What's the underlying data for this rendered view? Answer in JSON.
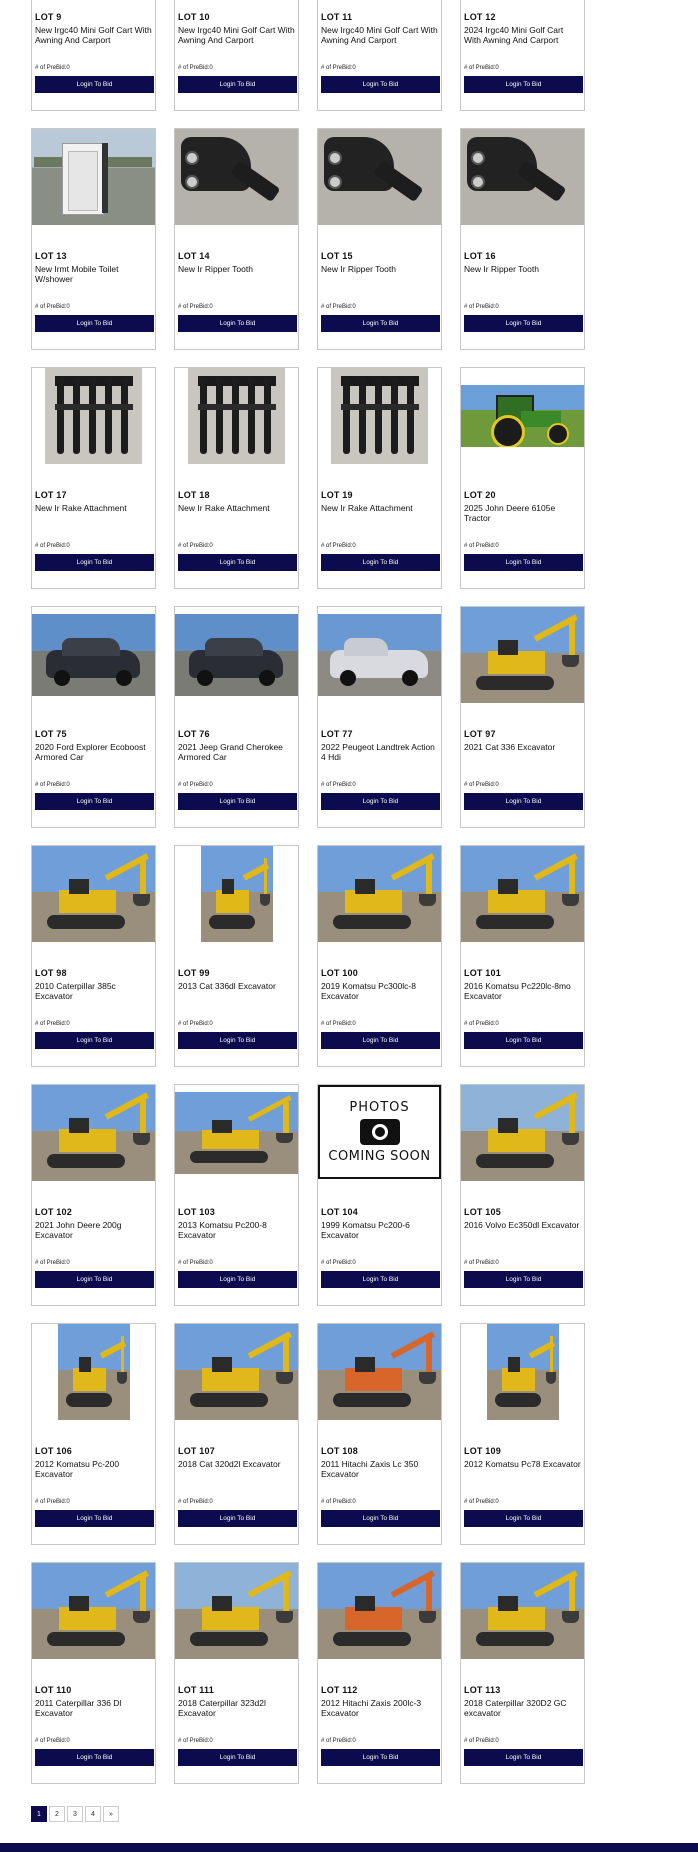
{
  "lots": [
    {
      "lot": "LOT 9",
      "title": "New Irgc40 Mini Golf Cart With Awning And Carport",
      "prebid": "# of PreBid:0",
      "button": "Login To Bid",
      "image": "none"
    },
    {
      "lot": "LOT 10",
      "title": "New Irgc40 Mini Golf Cart With Awning And Carport",
      "prebid": "# of PreBid:0",
      "button": "Login To Bid",
      "image": "none"
    },
    {
      "lot": "LOT 11",
      "title": "New Irgc40 Mini Golf Cart With Awning And Carport",
      "prebid": "# of PreBid:0",
      "button": "Login To Bid",
      "image": "none"
    },
    {
      "lot": "LOT 12",
      "title": "2024 Irgc40 Mini Golf Cart With Awning And Carport",
      "prebid": "# of PreBid:0",
      "button": "Login To Bid",
      "image": "none"
    },
    {
      "lot": "LOT 13",
      "title": "New Irmt Mobile Toilet W/shower",
      "prebid": "# of PreBid:0",
      "button": "Login To Bid",
      "image": "toilet"
    },
    {
      "lot": "LOT 14",
      "title": "New Ir Ripper Tooth",
      "prebid": "# of PreBid:0",
      "button": "Login To Bid",
      "image": "ripper"
    },
    {
      "lot": "LOT 15",
      "title": "New Ir Ripper Tooth",
      "prebid": "# of PreBid:0",
      "button": "Login To Bid",
      "image": "ripper"
    },
    {
      "lot": "LOT 16",
      "title": "New Ir Ripper Tooth",
      "prebid": "# of PreBid:0",
      "button": "Login To Bid",
      "image": "ripper"
    },
    {
      "lot": "LOT 17",
      "title": "New Ir Rake Attachment",
      "prebid": "# of PreBid:0",
      "button": "Login To Bid",
      "image": "rake"
    },
    {
      "lot": "LOT 18",
      "title": "New Ir Rake Attachment",
      "prebid": "# of PreBid:0",
      "button": "Login To Bid",
      "image": "rake"
    },
    {
      "lot": "LOT 19",
      "title": "New Ir Rake Attachment",
      "prebid": "# of PreBid:0",
      "button": "Login To Bid",
      "image": "rake"
    },
    {
      "lot": "LOT 20",
      "title": "2025 John Deere 6105e Tractor",
      "prebid": "# of PreBid:0",
      "button": "Login To Bid",
      "image": "tractor"
    },
    {
      "lot": "LOT 75",
      "title": "2020 Ford Explorer Ecoboost Armored Car",
      "prebid": "# of PreBid:0",
      "button": "Login To Bid",
      "image": "car-dark"
    },
    {
      "lot": "LOT 76",
      "title": "2021 Jeep Grand Cherokee Armored Car",
      "prebid": "# of PreBid:0",
      "button": "Login To Bid",
      "image": "car-dark"
    },
    {
      "lot": "LOT 77",
      "title": "2022 Peugeot Landtrek Action 4 Hdi",
      "prebid": "# of PreBid:0",
      "button": "Login To Bid",
      "image": "car-silver"
    },
    {
      "lot": "LOT 97",
      "title": "2021 Cat 336 Excavator",
      "prebid": "# of PreBid:0",
      "button": "Login To Bid",
      "image": "excavator"
    },
    {
      "lot": "LOT 98",
      "title": "2010 Caterpillar 385c Excavator",
      "prebid": "# of PreBid:0",
      "button": "Login To Bid",
      "image": "excavator"
    },
    {
      "lot": "LOT 99",
      "title": "2013 Cat 336dl Excavator",
      "prebid": "# of PreBid:0",
      "button": "Login To Bid",
      "image": "excavator-narrow"
    },
    {
      "lot": "LOT 100",
      "title": "2019 Komatsu Pc300lc-8 Excavator",
      "prebid": "# of PreBid:0",
      "button": "Login To Bid",
      "image": "excavator"
    },
    {
      "lot": "LOT 101",
      "title": "2016 Komatsu Pc220lc-8mo Excavator",
      "prebid": "# of PreBid:0",
      "button": "Login To Bid",
      "image": "excavator"
    },
    {
      "lot": "LOT 102",
      "title": "2021 John Deere 200g Excavator",
      "prebid": "# of PreBid:0",
      "button": "Login To Bid",
      "image": "excavator"
    },
    {
      "lot": "LOT 103",
      "title": "2013 Komatsu Pc200-8 Excavator",
      "prebid": "# of PreBid:0",
      "button": "Login To Bid",
      "image": "excavator-short"
    },
    {
      "lot": "LOT 104",
      "title": "1999 Komatsu Pc200-6 Excavator",
      "prebid": "# of PreBid:0",
      "button": "Login To Bid",
      "image": "coming-soon"
    },
    {
      "lot": "LOT 105",
      "title": "2016 Volvo Ec350dl Excavator",
      "prebid": "# of PreBid:0",
      "button": "Login To Bid",
      "image": "excavator-gray"
    },
    {
      "lot": "LOT 106",
      "title": "2012 Komatsu Pc-200 Excavator",
      "prebid": "# of PreBid:0",
      "button": "Login To Bid",
      "image": "excavator-narrow"
    },
    {
      "lot": "LOT 107",
      "title": "2018 Cat 320d2l Excavator",
      "prebid": "# of PreBid:0",
      "button": "Login To Bid",
      "image": "excavator"
    },
    {
      "lot": "LOT 108",
      "title": "2011 Hitachi Zaxis Lc 350 Excavator",
      "prebid": "# of PreBid:0",
      "button": "Login To Bid",
      "image": "excavator-orange"
    },
    {
      "lot": "LOT 109",
      "title": "2012 Komatsu Pc78 Excavator",
      "prebid": "# of PreBid:0",
      "button": "Login To Bid",
      "image": "excavator-narrow"
    },
    {
      "lot": "LOT 110",
      "title": "2011 Caterpillar 336 Dl Excavator",
      "prebid": "# of PreBid:0",
      "button": "Login To Bid",
      "image": "excavator"
    },
    {
      "lot": "LOT 111",
      "title": "2018 Caterpillar 323d2l Excavator",
      "prebid": "# of PreBid:0",
      "button": "Login To Bid",
      "image": "excavator-gray"
    },
    {
      "lot": "LOT 112",
      "title": "2012 Hitachi Zaxis 200lc-3 Excavator",
      "prebid": "# of PreBid:0",
      "button": "Login To Bid",
      "image": "excavator-orange"
    },
    {
      "lot": "LOT 113",
      "title": "2018 Caterpillar 320D2 GC excavator",
      "prebid": "# of PreBid:0",
      "button": "Login To Bid",
      "image": "excavator"
    }
  ],
  "coming_soon": {
    "line1": "PHOTOS",
    "line2": "COMING SOON"
  },
  "pagination": {
    "pages": [
      "1",
      "2",
      "3",
      "4"
    ],
    "active": "1",
    "next": "»"
  }
}
